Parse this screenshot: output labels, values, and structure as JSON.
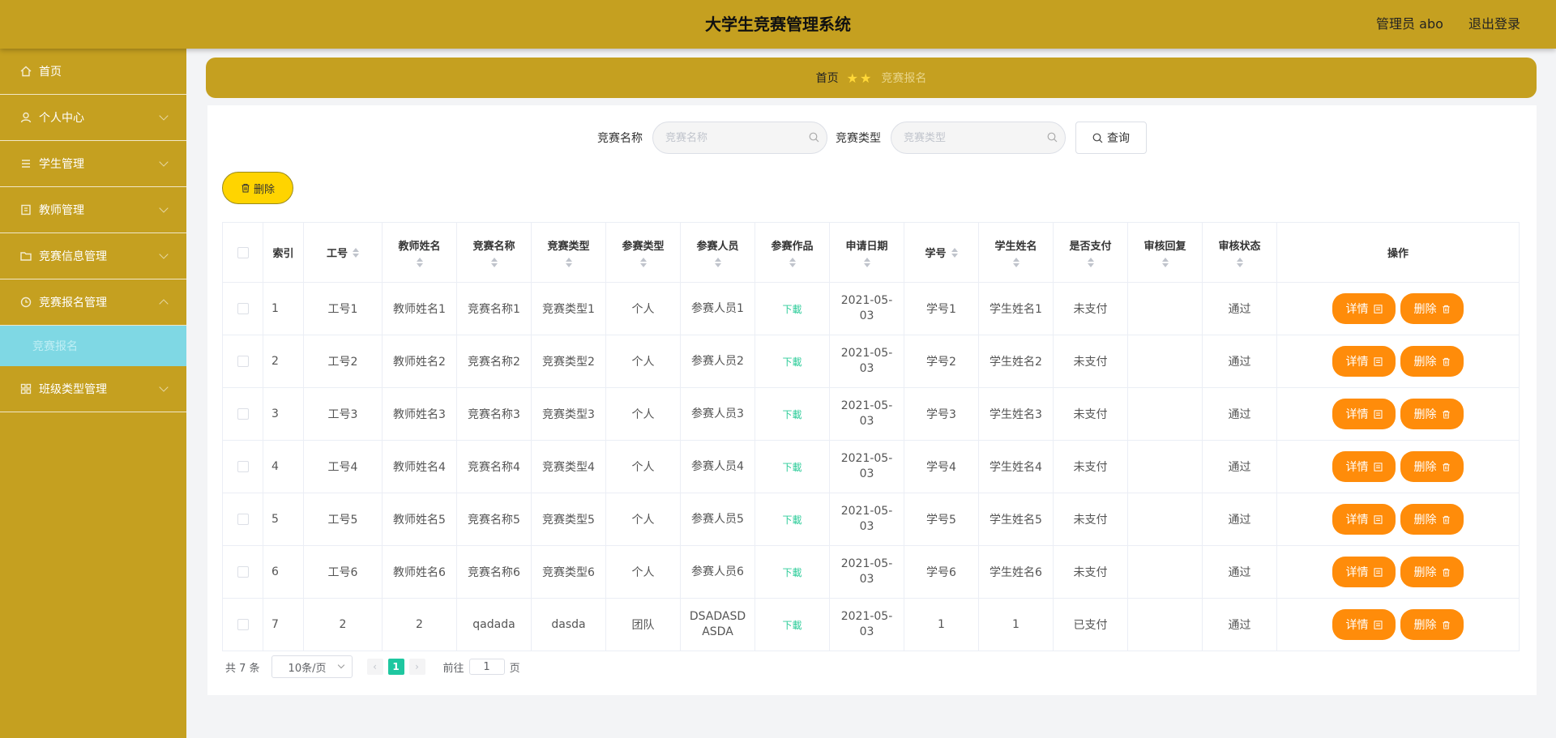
{
  "header": {
    "title": "大学生竞赛管理系统",
    "user_label": "管理员 abo",
    "logout_label": "退出登录"
  },
  "sidebar": {
    "items": [
      {
        "label": "首页",
        "icon": "home-icon"
      },
      {
        "label": "个人中心",
        "icon": "user-icon"
      },
      {
        "label": "学生管理",
        "icon": "list-icon"
      },
      {
        "label": "教师管理",
        "icon": "book-icon"
      },
      {
        "label": "竞赛信息管理",
        "icon": "folder-icon"
      },
      {
        "label": "竞赛报名管理",
        "icon": "clock-icon"
      },
      {
        "label": "班级类型管理",
        "icon": "grid-icon"
      }
    ],
    "active_sub": "竞赛报名"
  },
  "breadcrumb": {
    "home": "首页",
    "current": "竞赛报名"
  },
  "search": {
    "name_label": "竞赛名称",
    "name_placeholder": "竞赛名称",
    "type_label": "竞赛类型",
    "type_placeholder": "竞赛类型",
    "query_label": "查询"
  },
  "actions": {
    "bulk_delete_label": "删除"
  },
  "table": {
    "columns": [
      "索引",
      "工号",
      "教师姓名",
      "竞赛名称",
      "竞赛类型",
      "参赛类型",
      "参赛人员",
      "参赛作品",
      "申请日期",
      "学号",
      "学生姓名",
      "是否支付",
      "审核回复",
      "审核状态",
      "操作"
    ],
    "rows": [
      {
        "index": "1",
        "staff_no": "工号1",
        "teacher": "教师姓名1",
        "comp_name": "竞赛名称1",
        "comp_type": "竞赛类型1",
        "entry_type": "个人",
        "members": "参赛人员1",
        "work": "下載",
        "date": "2021-05-03",
        "student_no": "学号1",
        "student": "学生姓名1",
        "paid": "未支付",
        "reply": "",
        "status": "通过"
      },
      {
        "index": "2",
        "staff_no": "工号2",
        "teacher": "教师姓名2",
        "comp_name": "竞赛名称2",
        "comp_type": "竞赛类型2",
        "entry_type": "个人",
        "members": "参赛人员2",
        "work": "下載",
        "date": "2021-05-03",
        "student_no": "学号2",
        "student": "学生姓名2",
        "paid": "未支付",
        "reply": "",
        "status": "通过"
      },
      {
        "index": "3",
        "staff_no": "工号3",
        "teacher": "教师姓名3",
        "comp_name": "竞赛名称3",
        "comp_type": "竞赛类型3",
        "entry_type": "个人",
        "members": "参赛人员3",
        "work": "下載",
        "date": "2021-05-03",
        "student_no": "学号3",
        "student": "学生姓名3",
        "paid": "未支付",
        "reply": "",
        "status": "通过"
      },
      {
        "index": "4",
        "staff_no": "工号4",
        "teacher": "教师姓名4",
        "comp_name": "竞赛名称4",
        "comp_type": "竞赛类型4",
        "entry_type": "个人",
        "members": "参赛人员4",
        "work": "下載",
        "date": "2021-05-03",
        "student_no": "学号4",
        "student": "学生姓名4",
        "paid": "未支付",
        "reply": "",
        "status": "通过"
      },
      {
        "index": "5",
        "staff_no": "工号5",
        "teacher": "教师姓名5",
        "comp_name": "竞赛名称5",
        "comp_type": "竞赛类型5",
        "entry_type": "个人",
        "members": "参赛人员5",
        "work": "下載",
        "date": "2021-05-03",
        "student_no": "学号5",
        "student": "学生姓名5",
        "paid": "未支付",
        "reply": "",
        "status": "通过"
      },
      {
        "index": "6",
        "staff_no": "工号6",
        "teacher": "教师姓名6",
        "comp_name": "竞赛名称6",
        "comp_type": "竞赛类型6",
        "entry_type": "个人",
        "members": "参赛人员6",
        "work": "下載",
        "date": "2021-05-03",
        "student_no": "学号6",
        "student": "学生姓名6",
        "paid": "未支付",
        "reply": "",
        "status": "通过"
      },
      {
        "index": "7",
        "staff_no": "2",
        "teacher": "2",
        "comp_name": "qadada",
        "comp_type": "dasda",
        "entry_type": "团队",
        "members": "DSADASDASDA",
        "work": "下載",
        "date": "2021-05-03",
        "student_no": "1",
        "student": "1",
        "paid": "已支付",
        "reply": "",
        "status": "通过"
      }
    ],
    "detail_label": "详情",
    "delete_label": "删除"
  },
  "pagination": {
    "total_text": "共 7 条",
    "page_size": "10条/页",
    "current_page": "1",
    "goto_prefix": "前往",
    "goto_value": "1",
    "goto_suffix": "页"
  },
  "colors": {
    "header_bg": "#c5a020",
    "submenu_active_bg": "#7fd8e4",
    "op_button": "#ff8c0a",
    "bulk_delete": "#ffd400",
    "page_active": "#1ec7a0"
  }
}
